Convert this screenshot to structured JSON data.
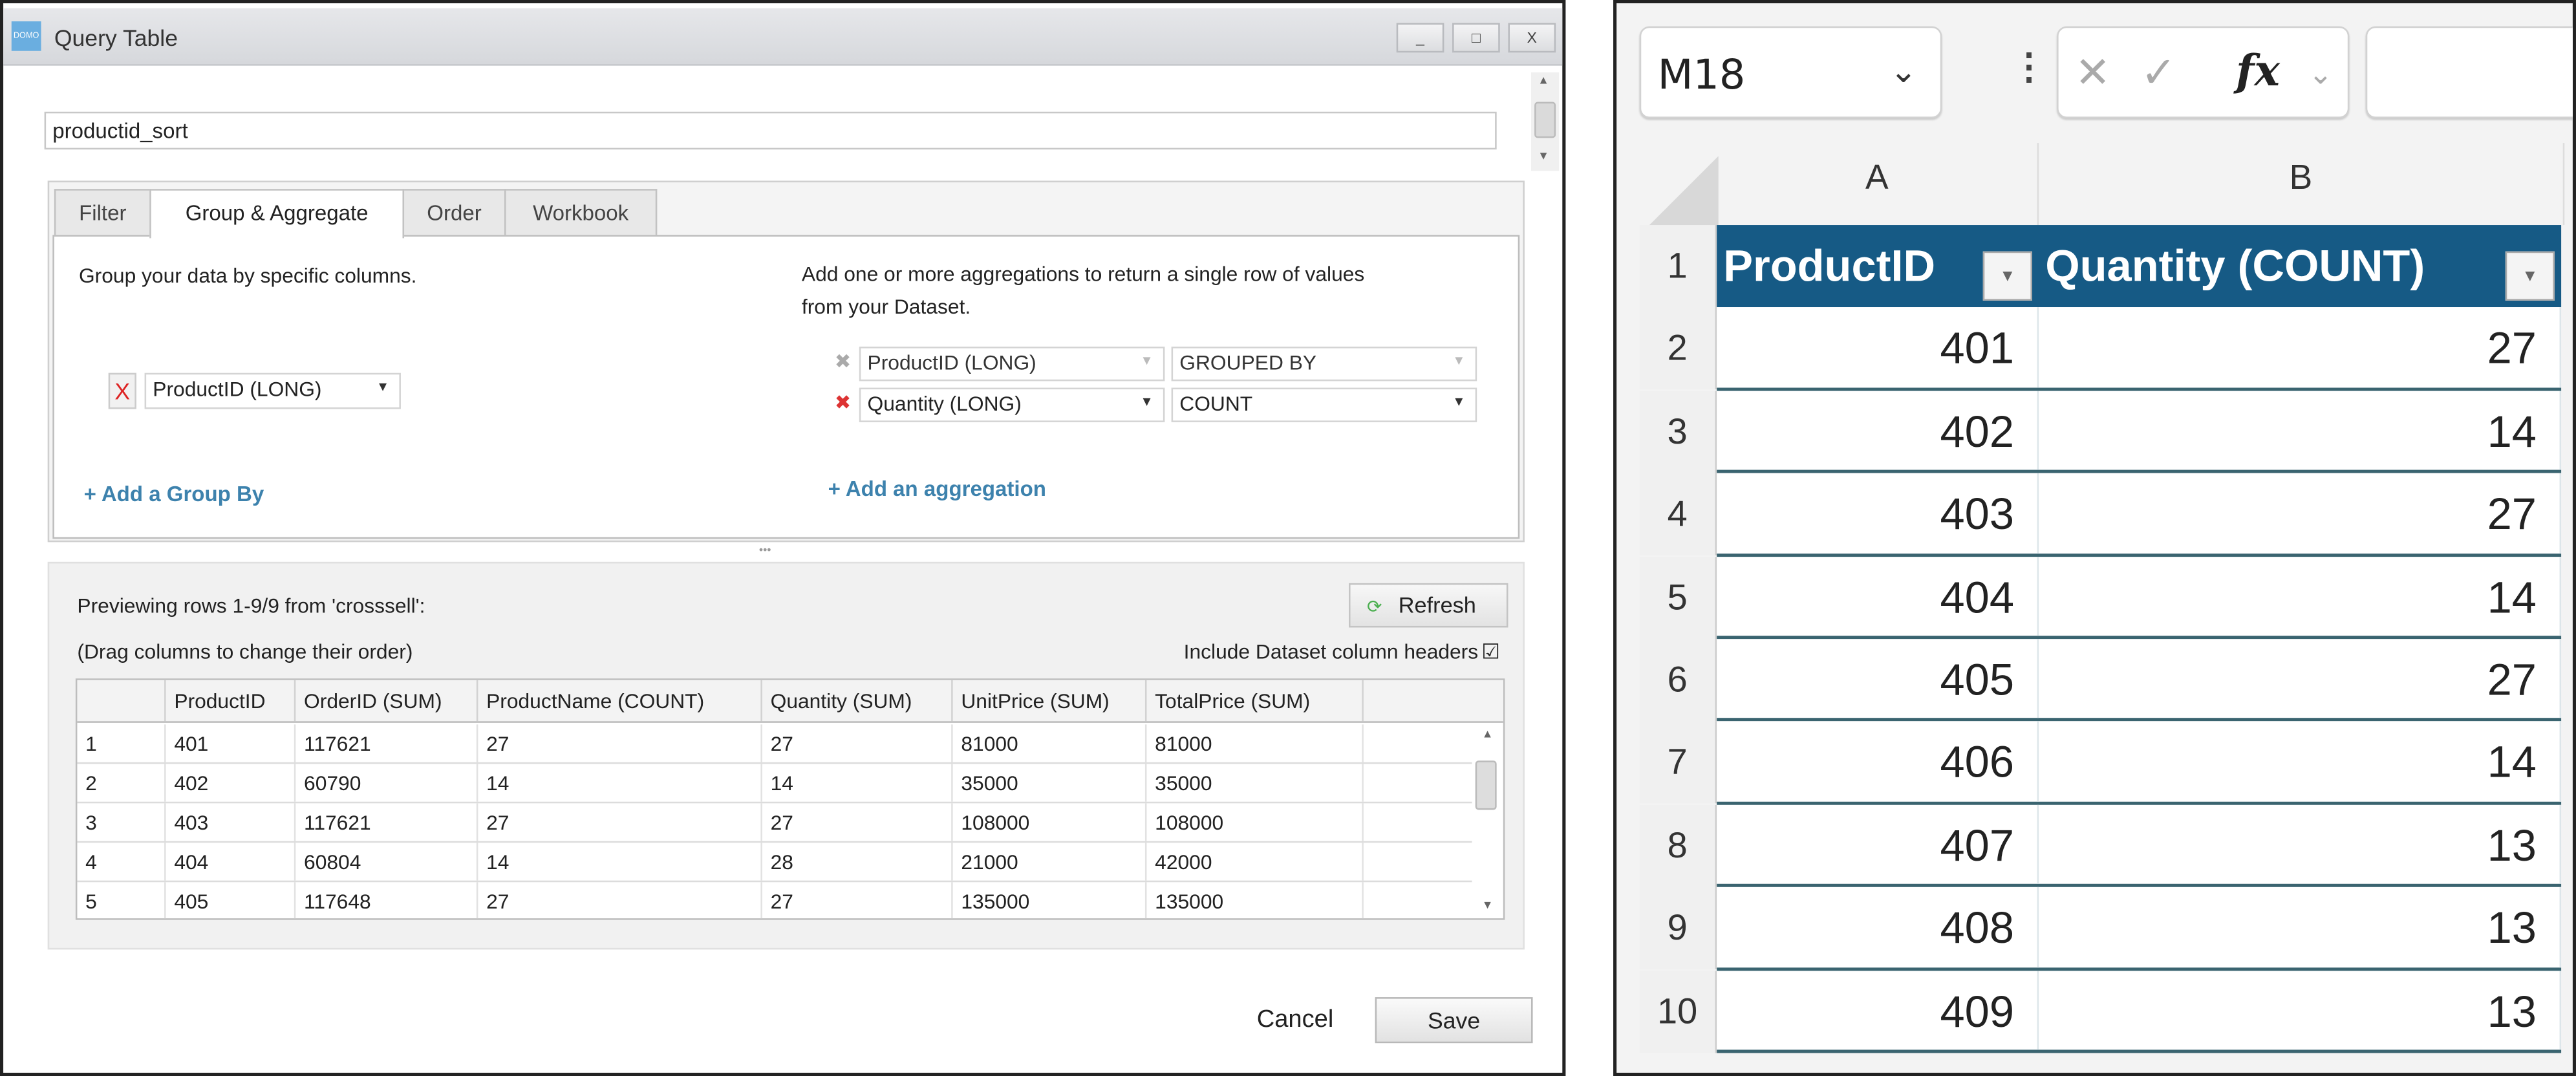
{
  "dialog": {
    "title": "Query Table",
    "logo_text": "DOMO",
    "window_buttons": [
      "_",
      "□",
      "X"
    ],
    "name_value": "productid_sort",
    "tabs": [
      {
        "label": "Filter"
      },
      {
        "label": "Group & Aggregate",
        "active": true
      },
      {
        "label": "Order"
      },
      {
        "label": "Workbook"
      }
    ],
    "group": {
      "description": "Group your data by specific columns.",
      "remove_label": "X",
      "column": "ProductID (LONG)",
      "add_label": "+ Add a Group By"
    },
    "aggregate": {
      "description_line1": "Add one or more aggregations to return a single row of values",
      "description_line2": "from your Dataset.",
      "rows": [
        {
          "column": "ProductID (LONG)",
          "function": "GROUPED BY",
          "disabled": true
        },
        {
          "column": "Quantity (LONG)",
          "function": "COUNT",
          "disabled": false
        }
      ],
      "add_label": "+ Add an aggregation"
    },
    "preview": {
      "status": "Previewing rows 1-9/9 from 'crosssell':",
      "hint": "(Drag columns to change their order)",
      "refresh_label": "Refresh",
      "include_headers_label": "Include Dataset column headers",
      "include_headers_checked": true,
      "columns": [
        "",
        "ProductID",
        "OrderID (SUM)",
        "ProductName (COUNT)",
        "Quantity (SUM)",
        "UnitPrice (SUM)",
        "TotalPrice (SUM)"
      ],
      "rows": [
        [
          "1",
          "401",
          "117621",
          "27",
          "27",
          "81000",
          "81000"
        ],
        [
          "2",
          "402",
          "60790",
          "14",
          "14",
          "35000",
          "35000"
        ],
        [
          "3",
          "403",
          "117621",
          "27",
          "27",
          "108000",
          "108000"
        ],
        [
          "4",
          "404",
          "60804",
          "14",
          "28",
          "21000",
          "42000"
        ],
        [
          "5",
          "405",
          "117648",
          "27",
          "27",
          "135000",
          "135000"
        ]
      ]
    },
    "cancel_label": "Cancel",
    "save_label": "Save"
  },
  "excel": {
    "name_box": "M18",
    "formula_icons": [
      "cancel-icon",
      "enter-icon",
      "fx-icon"
    ],
    "fx_label": "fx",
    "formula_value": "",
    "column_headers": [
      "A",
      "B"
    ],
    "header_color": "#165a85",
    "rows": [
      {
        "num": "1",
        "cells": [
          "ProductID",
          "Quantity (COUNT)"
        ],
        "header": true
      },
      {
        "num": "2",
        "cells": [
          "401",
          "27"
        ]
      },
      {
        "num": "3",
        "cells": [
          "402",
          "14"
        ]
      },
      {
        "num": "4",
        "cells": [
          "403",
          "27"
        ]
      },
      {
        "num": "5",
        "cells": [
          "404",
          "14"
        ]
      },
      {
        "num": "6",
        "cells": [
          "405",
          "27"
        ]
      },
      {
        "num": "7",
        "cells": [
          "406",
          "14"
        ]
      },
      {
        "num": "8",
        "cells": [
          "407",
          "13"
        ]
      },
      {
        "num": "9",
        "cells": [
          "408",
          "13"
        ]
      },
      {
        "num": "10",
        "cells": [
          "409",
          "13"
        ]
      }
    ]
  }
}
